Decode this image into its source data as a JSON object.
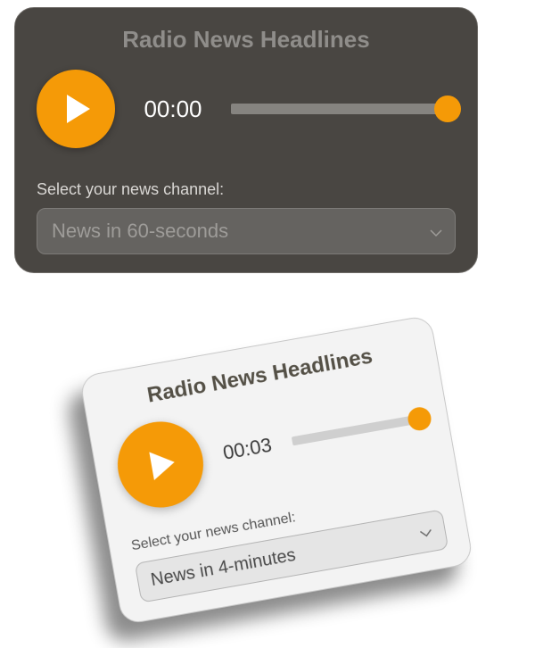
{
  "playerDark": {
    "title": "Radio News Headlines",
    "time": "00:00",
    "volumePercent": 100,
    "selectLabel": "Select your news channel:",
    "selectedOption": "News in 60-seconds",
    "accentColor": "#f59a07"
  },
  "playerLight": {
    "title": "Radio News Headlines",
    "time": "00:03",
    "volumePercent": 100,
    "selectLabel": "Select your news channel:",
    "selectedOption": "News in 4-minutes",
    "accentColor": "#f59a07"
  }
}
